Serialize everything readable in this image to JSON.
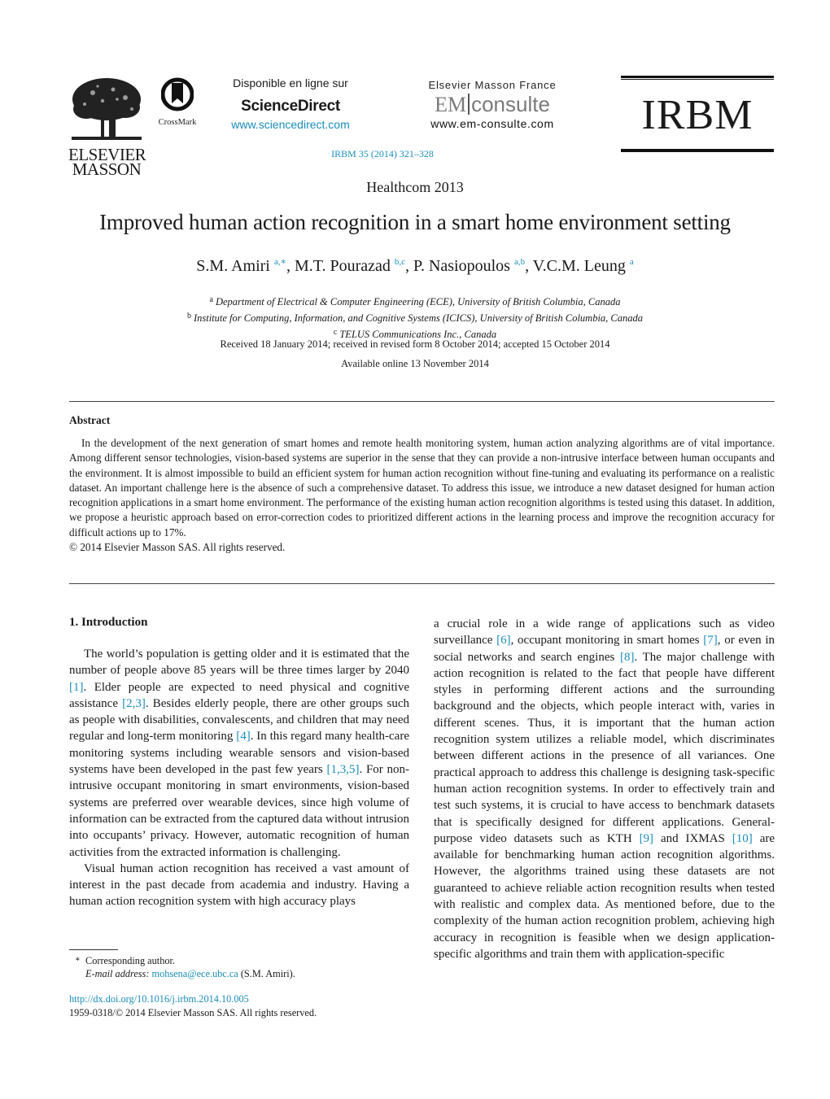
{
  "header": {
    "publisher_logo": {
      "line1": "ELSEVIER",
      "line2": "MASSON"
    },
    "crossmark": {
      "label": "CrossMark"
    },
    "sciencedirect": {
      "available_text": "Disponible en ligne sur",
      "brand": "ScienceDirect",
      "url": "www.sciencedirect.com"
    },
    "em_consulte": {
      "publisher": "Elsevier Masson France",
      "logo_em": "EM",
      "logo_consulte": "consulte",
      "url": "www.em-consulte.com"
    },
    "citation": "IRBM 35 (2014) 321–328",
    "journal_logo": "IRBM"
  },
  "article": {
    "section": "Healthcom 2013",
    "title": "Improved human action recognition in a smart home environment setting",
    "authors": [
      {
        "name": "S.M. Amiri",
        "sup": "a,∗"
      },
      {
        "name": "M.T. Pourazad",
        "sup": "b,c"
      },
      {
        "name": "P. Nasiopoulos",
        "sup": "a,b"
      },
      {
        "name": "V.C.M. Leung",
        "sup": "a"
      }
    ],
    "affiliations": [
      {
        "mark": "a",
        "text": "Department of Electrical & Computer Engineering (ECE), University of British Columbia, Canada"
      },
      {
        "mark": "b",
        "text": "Institute for Computing, Information, and Cognitive Systems (ICICS), University of British Columbia, Canada"
      },
      {
        "mark": "c",
        "text": "TELUS Communications Inc., Canada"
      }
    ],
    "dates": "Received 18 January 2014; received in revised form 8 October 2014; accepted 15 October 2014",
    "available_online": "Available online 13 November 2014"
  },
  "abstract": {
    "heading": "Abstract",
    "body": "In the development of the next generation of smart homes and remote health monitoring system, human action analyzing algorithms are of vital importance. Among different sensor technologies, vision-based systems are superior in the sense that they can provide a non-intrusive interface between human occupants and the environment. It is almost impossible to build an efficient system for human action recognition without fine-tuning and evaluating its performance on a realistic dataset. An important challenge here is the absence of such a comprehensive dataset. To address this issue, we introduce a new dataset designed for human action recognition applications in a smart home environment. The performance of the existing human action recognition algorithms is tested using this dataset. In addition, we propose a heuristic approach based on error-correction codes to prioritized different actions in the learning process and improve the recognition accuracy for difficult actions up to 17%.",
    "copyright": "© 2014 Elsevier Masson SAS. All rights reserved."
  },
  "introduction": {
    "heading": "1.  Introduction",
    "paragraphs": [
      [
        {
          "t": "The world’s population is getting older and it is estimated that the number of people above 85 years will be three times larger by 2040 "
        },
        {
          "ref": "[1]"
        },
        {
          "t": ". Elder people are expected to need physical and cognitive assistance "
        },
        {
          "ref": "[2,3]"
        },
        {
          "t": ". Besides elderly people, there are other groups such as people with disabilities, convalescents, and children that may need regular and long-term monitoring "
        },
        {
          "ref": "[4]"
        },
        {
          "t": ". In this regard many health-care monitoring systems including wearable sensors and vision-based systems have been developed in the past few years "
        },
        {
          "ref": "[1,3,5]"
        },
        {
          "t": ". For non-intrusive occupant monitoring in smart environments, vision-based systems are preferred over wearable devices, since high volume of information can be extracted from the captured data without intrusion into occupants’ privacy. However, automatic recognition of human activities from the extracted information is challenging."
        }
      ],
      [
        {
          "t": "Visual human action recognition has received a vast amount of interest in the past decade from academia and industry. Having a human action recognition system with high accuracy plays"
        }
      ]
    ],
    "right_column": [
      {
        "t": "a crucial role in a wide range of applications such as video surveillance "
      },
      {
        "ref": "[6]"
      },
      {
        "t": ", occupant monitoring in smart homes "
      },
      {
        "ref": "[7]"
      },
      {
        "t": ", or even in social networks and search engines "
      },
      {
        "ref": "[8]"
      },
      {
        "t": ". The major challenge with action recognition is related to the fact that people have different styles in performing different actions and the surrounding background and the objects, which people interact with, varies in different scenes. Thus, it is important that the human action recognition system utilizes a reliable model, which discriminates between different actions in the presence of all variances. One practical approach to address this challenge is designing task-specific human action recognition systems. In order to effectively train and test such systems, it is crucial to have access to benchmark datasets that is specifically designed for different applications. General-purpose video datasets such as KTH "
      },
      {
        "ref": "[9]"
      },
      {
        "t": " and IXMAS "
      },
      {
        "ref": "[10]"
      },
      {
        "t": " are available for benchmarking human action recognition algorithms. However, the algorithms trained using these datasets are not guaranteed to achieve reliable action recognition results when tested with realistic and complex data. As mentioned before, due to the complexity of the human action recognition problem, achieving high accuracy in recognition is feasible when we design application-specific algorithms and train them with application-specific"
      }
    ]
  },
  "footnotes": {
    "star": "∗",
    "corresponding": "Corresponding author.",
    "email_label": "E-mail address:",
    "email": "mohsena@ece.ubc.ca",
    "email_suffix": " (S.M. Amiri).",
    "doi": "http://dx.doi.org/10.1016/j.irbm.2014.10.005",
    "issn_line": "1959-0318/© 2014 Elsevier Masson SAS. All rights reserved."
  },
  "colors": {
    "link": "#1a8cb8",
    "text": "#1a1a1a"
  }
}
